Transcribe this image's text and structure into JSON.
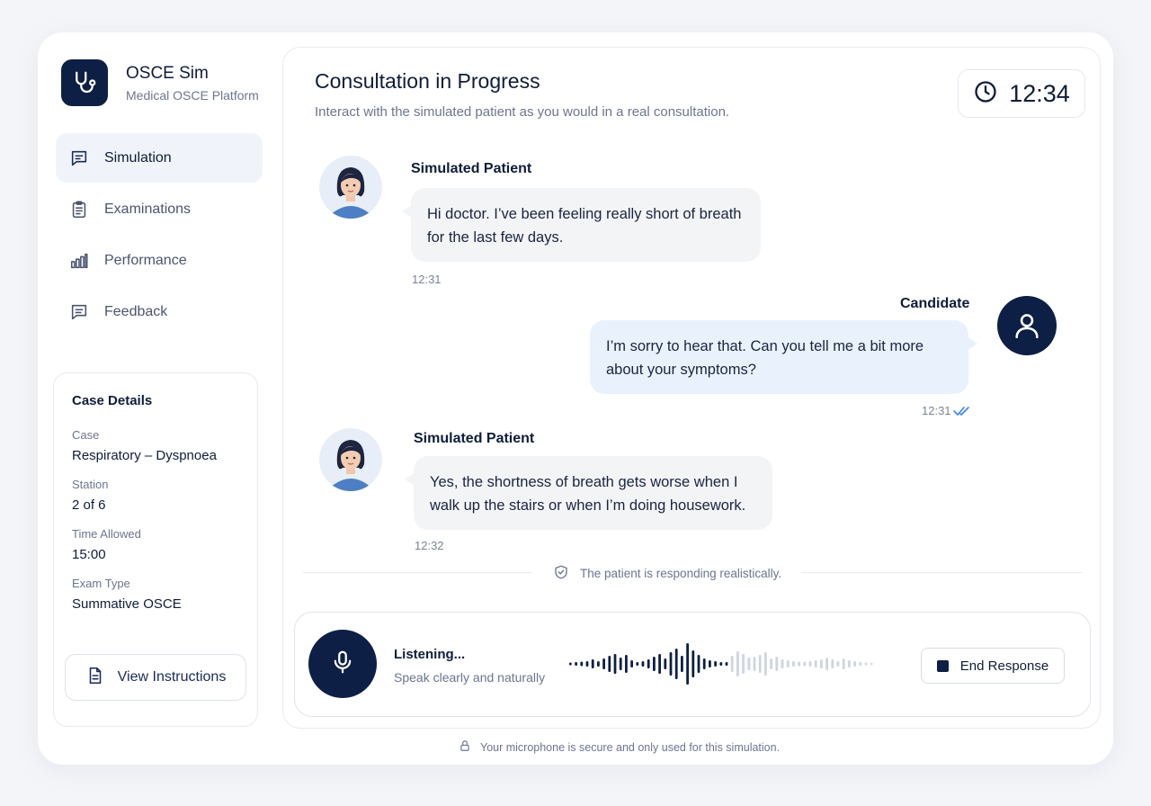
{
  "brand": {
    "name": "OSCE Sim",
    "subtitle": "Medical OSCE Platform",
    "logo_icon": "stethoscope-icon"
  },
  "sidebar": {
    "items": [
      {
        "label": "Simulation",
        "icon": "chat-square-icon",
        "active": true
      },
      {
        "label": "Examinations",
        "icon": "clipboard-icon",
        "active": false
      },
      {
        "label": "Performance",
        "icon": "bar-chart-icon",
        "active": false
      },
      {
        "label": "Feedback",
        "icon": "message-icon",
        "active": false
      }
    ]
  },
  "case_details": {
    "title": "Case Details",
    "fields": [
      {
        "label": "Case",
        "value": "Respiratory – Dyspnoea"
      },
      {
        "label": "Station",
        "value": "2 of 6"
      },
      {
        "label": "Time Allowed",
        "value": "15:00"
      },
      {
        "label": "Exam Type",
        "value": "Summative OSCE"
      }
    ],
    "button_label": "View Instructions"
  },
  "header": {
    "title": "Consultation in Progress",
    "subtitle": "Interact with the simulated patient as you would in a real consultation.",
    "timer": "12:34"
  },
  "messages": [
    {
      "speaker": "Simulated Patient",
      "text": "Hi doctor. I’ve been feeling really short of breath for the last few days.",
      "time": "12:31",
      "role": "patient"
    },
    {
      "speaker": "Candidate",
      "text": "I’m sorry to hear that. Can you tell me a bit more about your symptoms?",
      "time": "12:31",
      "role": "candidate",
      "read": true
    },
    {
      "speaker": "Simulated Patient",
      "text": "Yes, the shortness of breath gets worse when I walk up the stairs or when I’m doing housework.",
      "time": "12:32",
      "role": "patient"
    }
  ],
  "status_note": "The patient is responding realistically.",
  "voice": {
    "title": "Listening...",
    "subtitle": "Speak clearly and naturally",
    "end_label": "End Response"
  },
  "footer": "Your microphone is secure and only used for this simulation.",
  "colors": {
    "navy": "#0e1f45",
    "candidate_bubble": "#e9f1fd",
    "patient_bubble": "#f3f4f6",
    "accent_blue": "#3b82f6"
  }
}
